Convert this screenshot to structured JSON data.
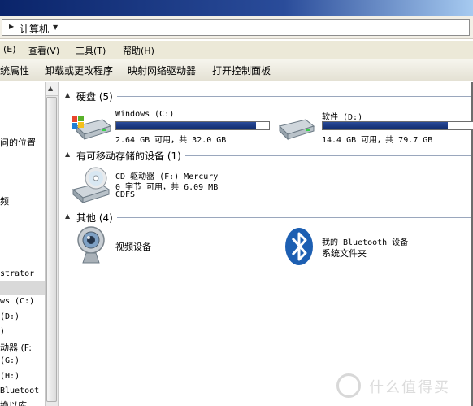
{
  "address": {
    "path_label": "计算机"
  },
  "menu": {
    "items": [
      "(E)",
      "查看(V)",
      "工具(T)",
      "帮助(H)"
    ]
  },
  "toolbar": {
    "items": [
      "统属性",
      "卸载或更改程序",
      "映射网络驱动器",
      "打开控制面板"
    ]
  },
  "nav": {
    "items": [
      "问的位置",
      "频",
      "strator",
      "ws (C:)",
      "(D:)",
      ")",
      "动器 (F:",
      "(G:)",
      "(H:)",
      "Bluetoot",
      "换以库"
    ]
  },
  "groups": {
    "hdd": {
      "title": "硬盘 (5)"
    },
    "removable": {
      "title": "有可移动存储的设备 (1)"
    },
    "other": {
      "title": "其他 (4)"
    }
  },
  "drives": [
    {
      "name": "Windows (C:)",
      "free": "2.64 GB 可用，共 32.0 GB",
      "used_fraction": 0.917
    },
    {
      "name": "软件 (D:)",
      "free": "14.4 GB 可用，共 79.7 GB",
      "used_fraction": 0.819
    }
  ],
  "cd": {
    "name": "CD 驱动器 (F:) Mercury",
    "free": "0 字节 可用，共 6.09 MB",
    "fs": "CDFS"
  },
  "others": [
    {
      "label": "视频设备"
    },
    {
      "label1": "我的 Bluetooth 设备",
      "label2": "系统文件夹"
    }
  ],
  "watermark": {
    "text": "什么值得买"
  },
  "colors": {
    "drive_fill": "#1f3d82",
    "title_bar": "#0a246a"
  }
}
